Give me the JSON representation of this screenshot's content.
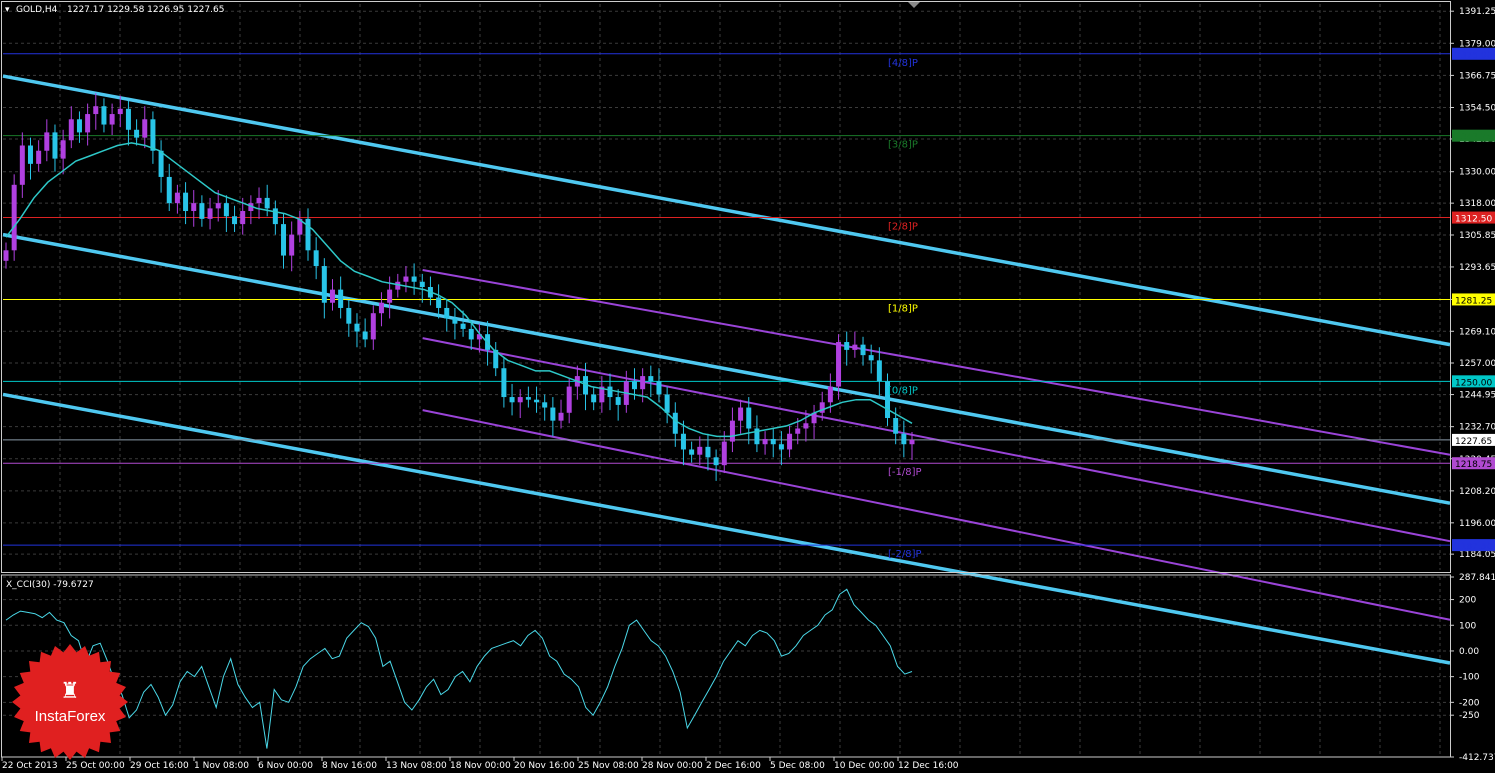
{
  "header": {
    "symbol": "GOLD,H4",
    "ohlc": "1227.17 1229.58 1226.95 1227.65"
  },
  "cci_header": "X_CCI(30) -79.6727",
  "logo_text": "InstaForex",
  "price_axis": {
    "min": 1178.0,
    "max": 1394.0,
    "ticks": [
      "1391.25",
      "1379.00",
      "1366.75",
      "1354.50",
      "1342.50",
      "1330.00",
      "1318.00",
      "1305.85",
      "1293.65",
      "1281.25",
      "1269.10",
      "1257.00",
      "1244.95",
      "1232.70",
      "1220.45",
      "1208.20",
      "1196.00",
      "1184.05"
    ]
  },
  "cci_axis": {
    "min": -412.7374,
    "max": 287.8411,
    "ticks": [
      "287.8411",
      "200",
      "100",
      "0.00",
      "-100",
      "-200",
      "-250",
      "-412.7374"
    ]
  },
  "time_labels": [
    "22 Oct 2013",
    "25 Oct 00:00",
    "29 Oct 16:00",
    "1 Nov 08:00",
    "6 Nov 00:00",
    "8 Nov 16:00",
    "13 Nov 08:00",
    "18 Nov 00:00",
    "20 Nov 16:00",
    "25 Nov 08:00",
    "28 Nov 00:00",
    "2 Dec 16:00",
    "5 Dec 08:00",
    "10 Dec 00:00",
    "12 Dec 16:00"
  ],
  "murrey_levels": [
    {
      "label": "[4/8]P",
      "price": 1375.0,
      "value": "1375.00",
      "color": "#2233dd",
      "text_color": "#2233dd"
    },
    {
      "label": "[3/8]P",
      "price": 1343.75,
      "value": "1343.75",
      "color": "#1a7a2a",
      "text_color": "#1a7a2a"
    },
    {
      "label": "[2/8]P",
      "price": 1312.5,
      "value": "1312.50",
      "color": "#dd2222",
      "text_color": "#ffffff"
    },
    {
      "label": "[1/8]P",
      "price": 1281.25,
      "value": "1281.25",
      "color": "#ffff00",
      "text_color": "#000000"
    },
    {
      "label": "[0/8]P",
      "price": 1250.0,
      "value": "1250.00",
      "color": "#00c8c8",
      "text_color": "#000000"
    },
    {
      "label": "[-1/8]P",
      "price": 1218.75,
      "value": "1218.75",
      "color": "#b04ad0",
      "text_color": "#000000"
    },
    {
      "label": "[-2/8]P",
      "price": 1187.5,
      "value": "1187.50",
      "color": "#2233dd",
      "text_color": "#2233dd"
    }
  ],
  "current_price": {
    "price": 1227.65,
    "value": "1227.65"
  },
  "colors": {
    "bull": "#b040e0",
    "bear": "#29c5e8",
    "ma": "#2ec8c8",
    "channel_blue": "#4fc8f0",
    "channel_purple": "#9a44d8",
    "cci": "#4ad8e8",
    "grid": "#3b3b3b",
    "logo": "#e02020"
  },
  "chart_data": {
    "type": "candlestick",
    "symbol": "GOLD",
    "timeframe": "H4",
    "closes": [
      1300,
      1325,
      1340,
      1333,
      1338,
      1345,
      1335,
      1342,
      1350,
      1345,
      1352,
      1355,
      1348,
      1352,
      1354,
      1346,
      1343,
      1350,
      1338,
      1328,
      1318,
      1322,
      1315,
      1318,
      1312,
      1316,
      1318,
      1313,
      1310,
      1315,
      1318,
      1320,
      1316,
      1310,
      1298,
      1306,
      1312,
      1300,
      1294,
      1280,
      1285,
      1278,
      1272,
      1269,
      1266,
      1276,
      1280,
      1285,
      1288,
      1290,
      1288,
      1286,
      1282,
      1278,
      1274,
      1272,
      1270,
      1266,
      1268,
      1262,
      1255,
      1244,
      1242,
      1244,
      1243,
      1242,
      1240,
      1235,
      1238,
      1248,
      1252,
      1245,
      1242,
      1248,
      1244,
      1241,
      1250,
      1247,
      1252,
      1250,
      1245,
      1238,
      1230,
      1224,
      1222,
      1225,
      1221,
      1218,
      1227,
      1235,
      1240,
      1232,
      1226,
      1228,
      1226,
      1224,
      1230,
      1232,
      1234,
      1238,
      1242,
      1248,
      1265,
      1262,
      1264,
      1260,
      1258,
      1250,
      1236,
      1230,
      1226,
      1227.65
    ],
    "moving_average": [
      1305,
      1312,
      1320,
      1326,
      1330,
      1334,
      1336,
      1338,
      1340,
      1341,
      1340,
      1338,
      1334,
      1330,
      1326,
      1322,
      1320,
      1318,
      1316,
      1315,
      1314,
      1312,
      1308,
      1302,
      1296,
      1292,
      1290,
      1288,
      1287,
      1286,
      1285,
      1283,
      1280,
      1275,
      1268,
      1262,
      1258,
      1256,
      1254,
      1254,
      1252,
      1250,
      1248,
      1247,
      1246,
      1245,
      1244,
      1240,
      1235,
      1232,
      1230,
      1229,
      1229,
      1230,
      1231,
      1232,
      1233,
      1235,
      1238,
      1240,
      1242,
      1243,
      1243,
      1240,
      1237,
      1234
    ],
    "channel_blue": [
      {
        "x": [
          0,
          1
        ],
        "y": [
          1366.5,
          1264.0
        ]
      },
      {
        "x": [
          0,
          1
        ],
        "y": [
          1306.0,
          1203.5
        ]
      },
      {
        "x": [
          0,
          1
        ],
        "y": [
          1245.0,
          1142.5
        ]
      }
    ],
    "channel_purple": [
      {
        "x": [
          0.29,
          1
        ],
        "y": [
          1292.5,
          1222.0
        ]
      },
      {
        "x": [
          0.29,
          1
        ],
        "y": [
          1266.5,
          1189.0
        ]
      },
      {
        "x": [
          0.29,
          1
        ],
        "y": [
          1239.0,
          1159.0
        ]
      }
    ],
    "cci": [
      120,
      140,
      155,
      150,
      145,
      130,
      150,
      120,
      110,
      60,
      40,
      -50,
      20,
      30,
      -40,
      -120,
      -170,
      -260,
      -230,
      -160,
      -130,
      -180,
      -250,
      -210,
      -120,
      -80,
      -100,
      -60,
      -140,
      -220,
      -100,
      -30,
      -130,
      -180,
      -220,
      -200,
      -380,
      -150,
      -190,
      -200,
      -140,
      -60,
      -30,
      -10,
      10,
      -30,
      -20,
      50,
      80,
      110,
      95,
      50,
      -60,
      -40,
      -120,
      -200,
      -230,
      -190,
      -140,
      -110,
      -170,
      -150,
      -100,
      -80,
      -120,
      -60,
      -20,
      10,
      20,
      30,
      40,
      20,
      60,
      80,
      50,
      -20,
      -40,
      -90,
      -110,
      -140,
      -220,
      -250,
      -200,
      -140,
      -60,
      10,
      100,
      120,
      80,
      40,
      20,
      -20,
      -80,
      -160,
      -300,
      -250,
      -200,
      -150,
      -100,
      -40,
      0,
      40,
      20,
      60,
      80,
      70,
      40,
      -20,
      -10,
      20,
      60,
      80,
      100,
      140,
      160,
      220,
      240,
      180,
      150,
      120,
      100,
      60,
      20,
      -60,
      -90,
      -80
    ]
  }
}
